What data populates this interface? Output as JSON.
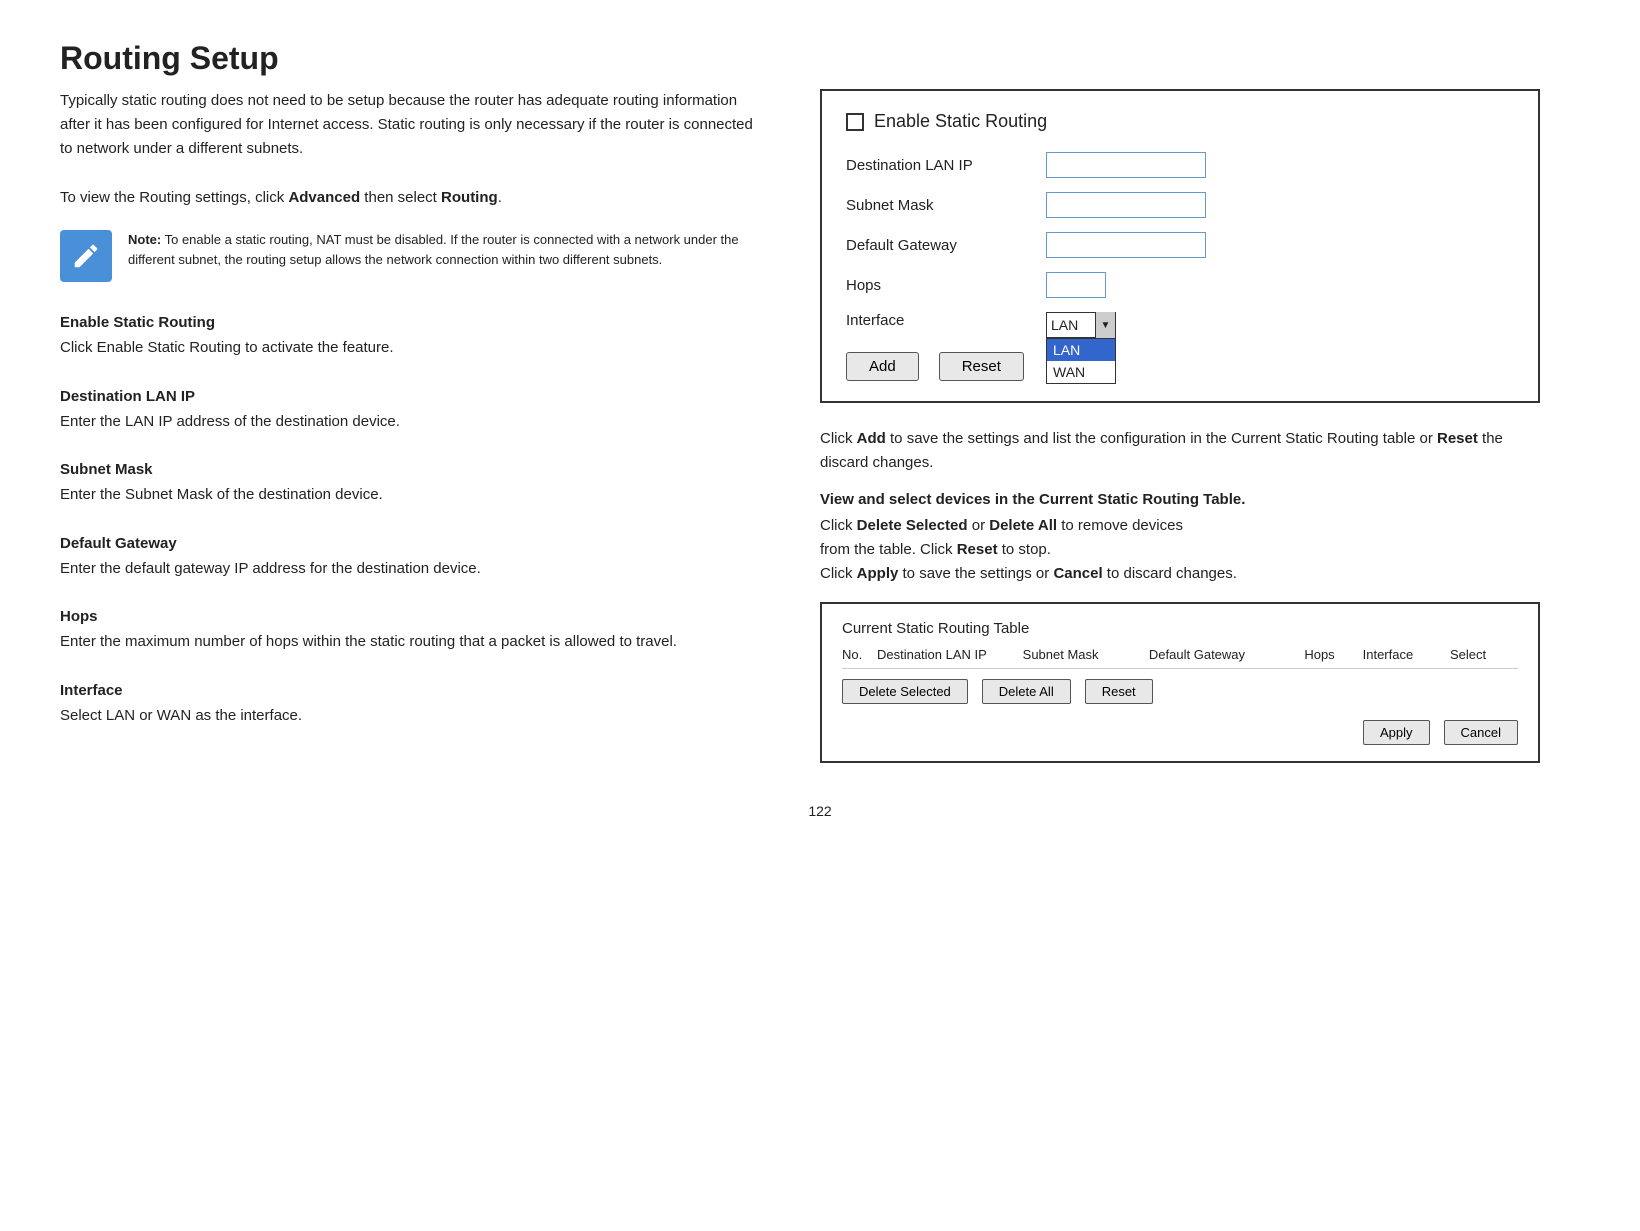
{
  "page": {
    "title": "Routing Setup",
    "intro": "Typically static routing does not need to be setup because the router has adequate routing information after it has been configured for Internet access. Static routing is only necessary if the router is connected to network under a different subnets.",
    "view_text_prefix": "To view the Routing settings, click ",
    "view_text_bold1": "Advanced",
    "view_text_mid": " then select ",
    "view_text_bold2": "Routing",
    "view_text_suffix": ".",
    "page_number": "122"
  },
  "note": {
    "label": "Note:",
    "text": "To enable a static routing, NAT must be disabled. If the router is connected with a network under the different subnet, the routing setup allows the network connection within two different subnets."
  },
  "sections": [
    {
      "title": "Enable Static Routing",
      "body": "Click Enable Static Routing to activate the feature."
    },
    {
      "title": "Destination LAN IP",
      "body": "Enter the LAN IP address of the destination device."
    },
    {
      "title": "Subnet Mask",
      "body": "Enter the Subnet Mask of the destination device."
    },
    {
      "title": "Default Gateway",
      "body": "Enter the default gateway IP address for the destination device."
    },
    {
      "title": "Hops",
      "body": "Enter the maximum number of hops within the static routing that a packet is allowed to travel."
    },
    {
      "title": "Interface",
      "body": "Select LAN or WAN as the interface."
    }
  ],
  "routing_panel": {
    "enable_label": "Enable Static Routing",
    "fields": [
      {
        "label": "Destination LAN IP",
        "type": "normal"
      },
      {
        "label": "Subnet Mask",
        "type": "normal"
      },
      {
        "label": "Default Gateway",
        "type": "normal"
      },
      {
        "label": "Hops",
        "type": "small"
      },
      {
        "label": "Interface",
        "type": "interface"
      }
    ],
    "interface_options": [
      "LAN",
      "WAN"
    ],
    "interface_selected": "LAN",
    "interface_dropdown_visible": true,
    "add_button": "Add",
    "reset_button": "Reset"
  },
  "click_description": {
    "text1_prefix": "Click ",
    "text1_bold": "Add",
    "text1_mid": " to save the settings and list the configuration in the Current Static Routing table or ",
    "text1_bold2": "Reset",
    "text1_suffix": " the discard changes."
  },
  "view_select_section": {
    "bold_text": "View and select devices in the Current Static Routing Table.",
    "line1_prefix": "Click ",
    "line1_bold": "Delete Selected",
    "line1_mid": " or ",
    "line1_bold2": "Delete All",
    "line1_suffix": " to remove devices",
    "line2": "from the table. Click ",
    "line2_bold": "Reset",
    "line2_suffix": " to stop.",
    "line3_prefix": "Click ",
    "line3_bold": "Apply",
    "line3_mid": " to save the settings or ",
    "line3_bold2": "Cancel",
    "line3_suffix": " to discard changes."
  },
  "routing_table": {
    "title": "Current Static Routing Table",
    "columns": [
      "No.",
      "Destination LAN IP",
      "Subnet Mask",
      "Default Gateway",
      "Hops",
      "Interface",
      "Select"
    ],
    "delete_selected_btn": "Delete Selected",
    "delete_all_btn": "Delete All",
    "reset_btn": "Reset",
    "apply_btn": "Apply",
    "cancel_btn": "Cancel"
  }
}
